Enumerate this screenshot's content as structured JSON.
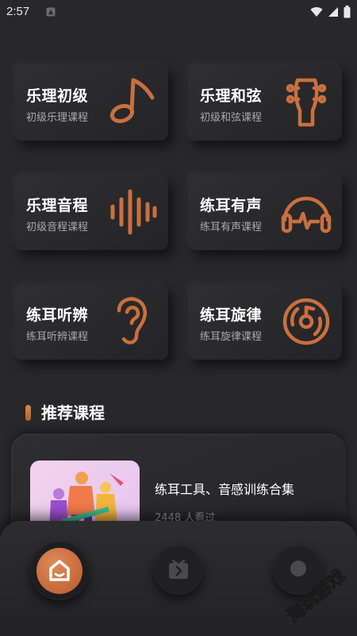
{
  "status": {
    "time": "2:57"
  },
  "accent": "#c9703f",
  "cards": [
    {
      "title": "乐理初级",
      "subtitle": "初级乐理课程",
      "icon": "music-note-icon"
    },
    {
      "title": "乐理和弦",
      "subtitle": "初级和弦课程",
      "icon": "guitar-head-icon"
    },
    {
      "title": "乐理音程",
      "subtitle": "初级音程课程",
      "icon": "sound-wave-icon"
    },
    {
      "title": "练耳有声",
      "subtitle": "练耳有声课程",
      "icon": "headphones-icon"
    },
    {
      "title": "练耳听辨",
      "subtitle": "练耳听辨课程",
      "icon": "ear-icon"
    },
    {
      "title": "练耳旋律",
      "subtitle": "练耳旋律课程",
      "icon": "vinyl-disc-icon"
    }
  ],
  "section": {
    "title": "推荐课程"
  },
  "recommended": {
    "title": "练耳工具、音感训练合集",
    "meta": "2448 人看过"
  },
  "nav": {
    "items": [
      "home-icon",
      "play-icon",
      "profile-icon"
    ]
  },
  "watermark": {
    "text": "淘玩游戏"
  }
}
